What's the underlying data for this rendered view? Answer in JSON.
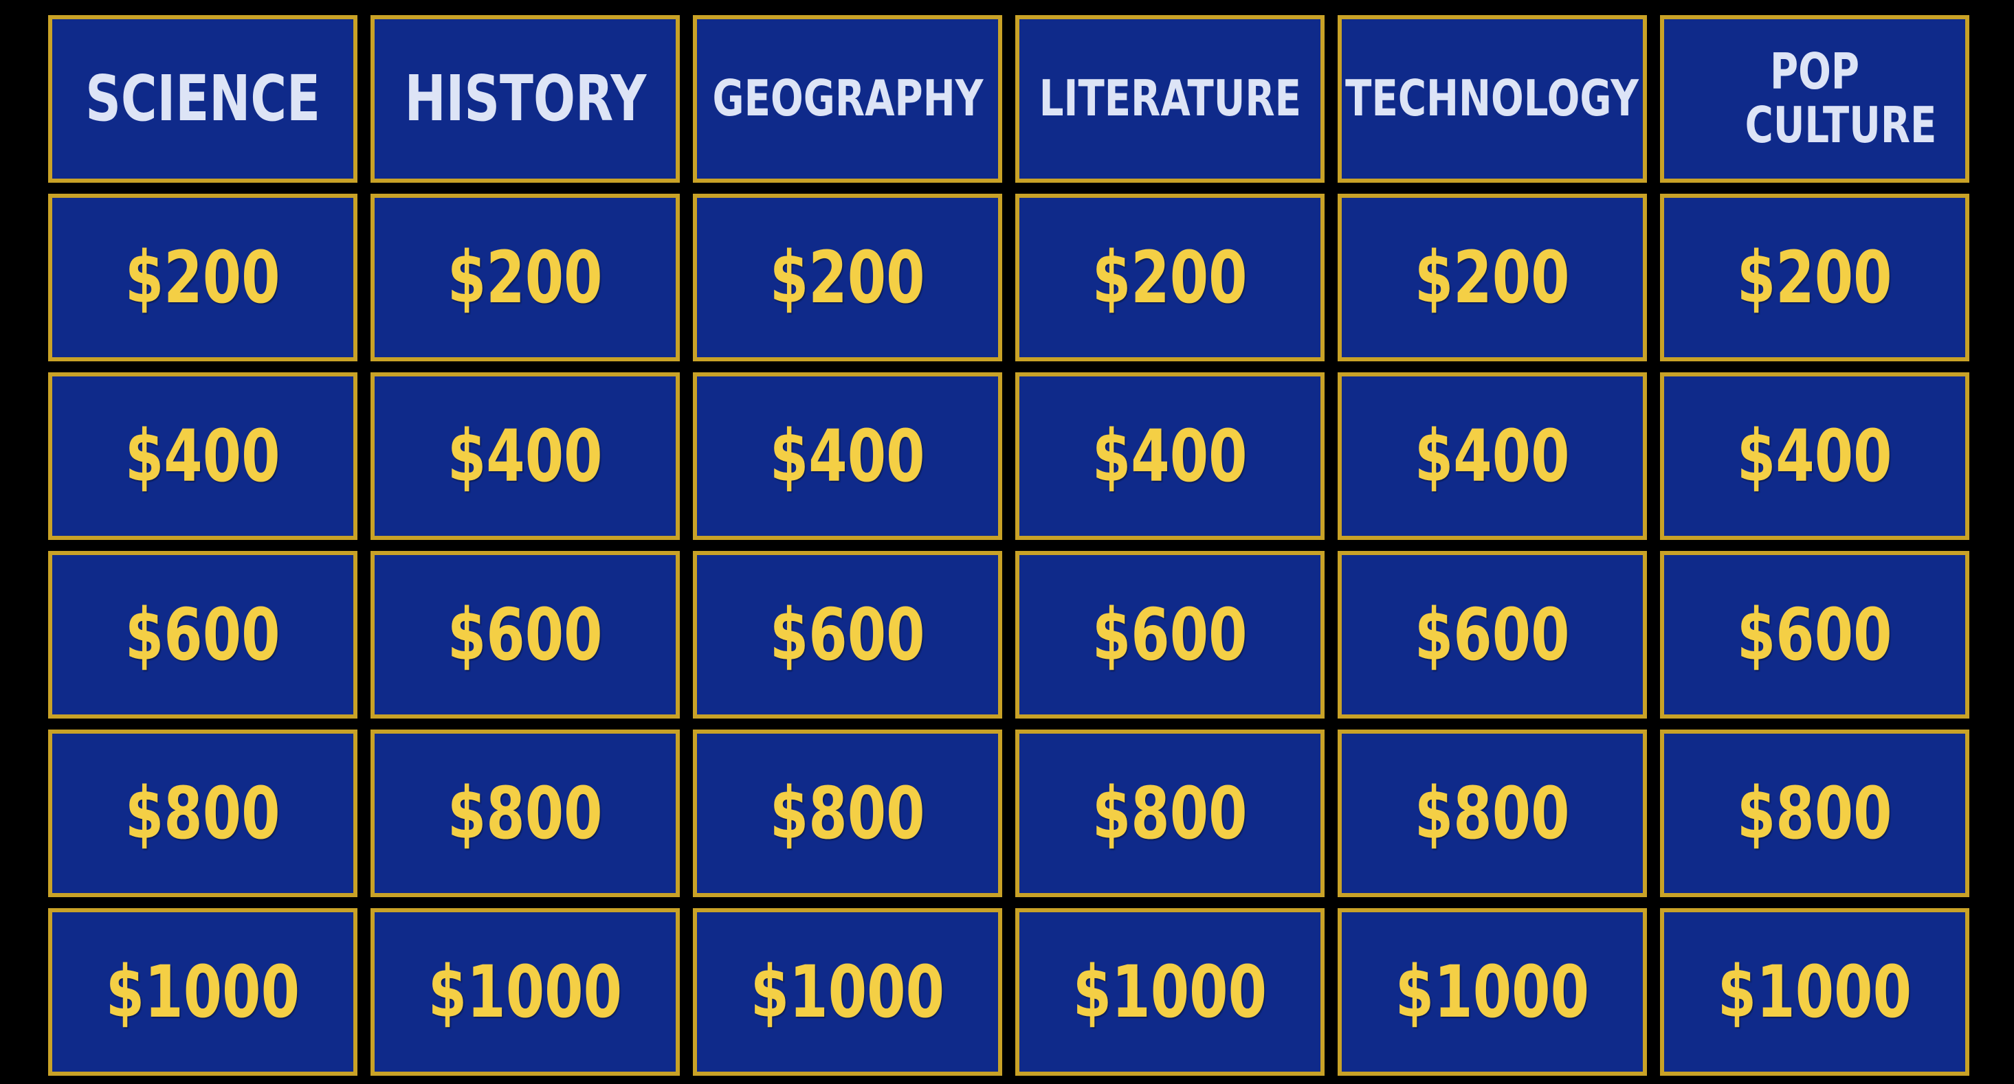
{
  "board": {
    "categories": [
      "SCIENCE",
      "HISTORY",
      "GEOGRAPHY",
      "LITERATURE",
      "TECHNOLOGY",
      "POP CULTURE"
    ],
    "values": [
      "$200",
      "$400",
      "$600",
      "$800",
      "$1000"
    ]
  },
  "colors": {
    "background": "#000000",
    "tile": "#0f2a8a",
    "border": "#c9a227",
    "category_text": "#dde4f6",
    "value_text": "#f4cf45"
  }
}
